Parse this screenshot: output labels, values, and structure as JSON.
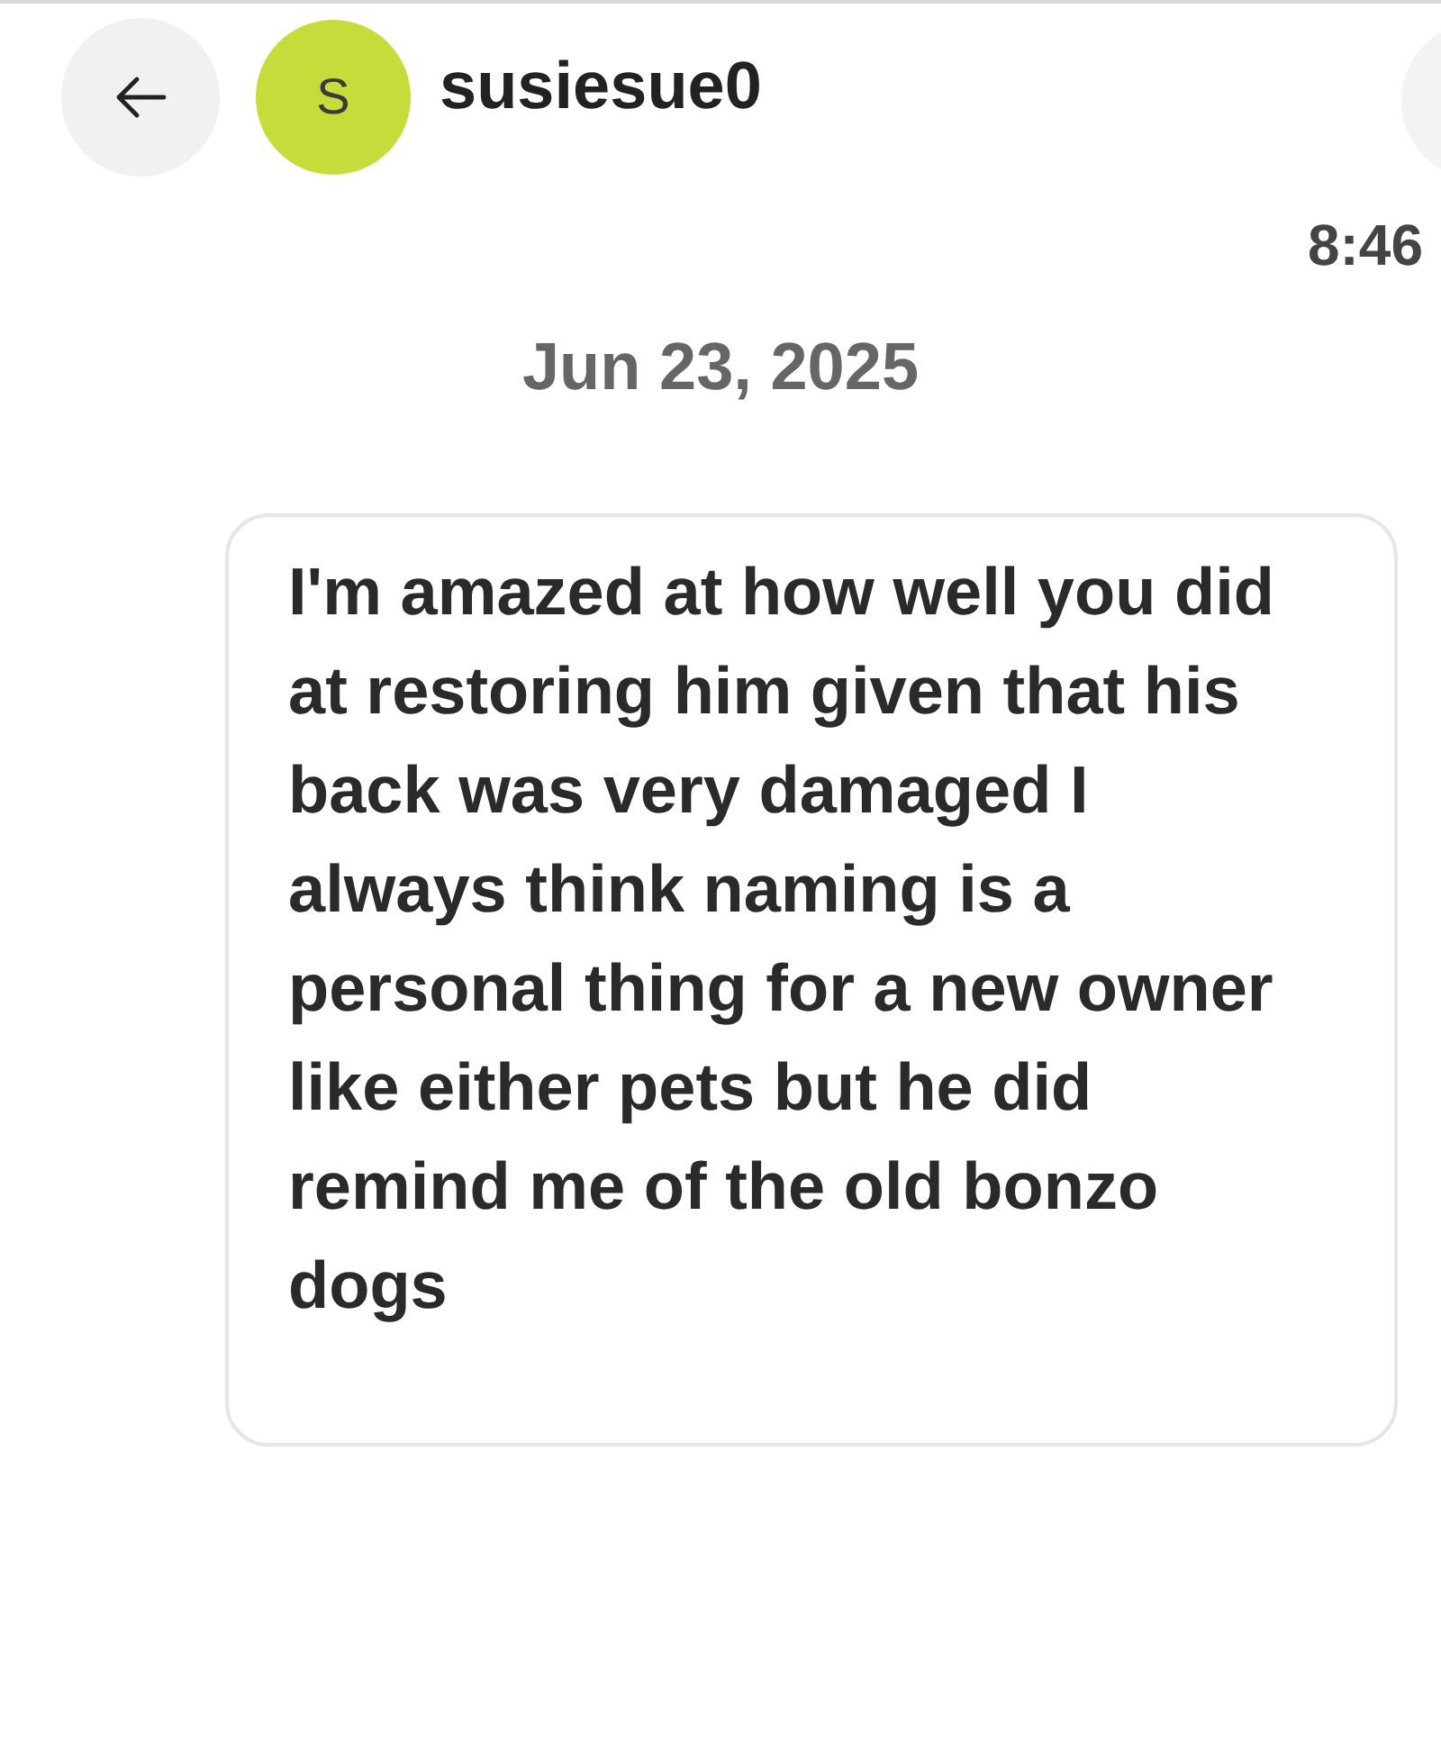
{
  "header": {
    "avatar_letter": "S",
    "username": "susiesue0"
  },
  "time": "8:46",
  "date": "Jun 23, 2025",
  "messages": [
    {
      "text": "I'm amazed at how well you did at restoring him given that his back was very damaged I always think naming is a personal thing for a new owner like either pets but he did remind me of the old bonzo dogs"
    }
  ]
}
